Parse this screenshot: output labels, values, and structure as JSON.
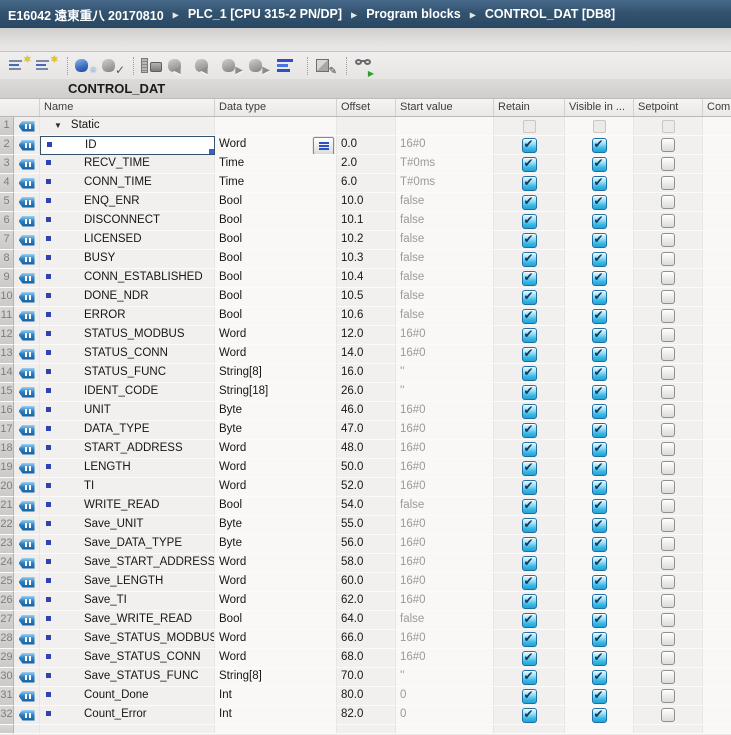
{
  "breadcrumb": {
    "segments": [
      "E16042 遠東重八 20170810",
      "PLC_1 [CPU 315-2 PN/DP]",
      "Program blocks",
      "CONTROL_DAT [DB8]"
    ]
  },
  "toolbar": {
    "icons": [
      {
        "name": "insert-row",
        "kind": "rows-star"
      },
      {
        "name": "add-row",
        "kind": "rows-star"
      },
      {
        "name": "sep1",
        "kind": "sep"
      },
      {
        "name": "keep-actual-values",
        "kind": "db-blue"
      },
      {
        "name": "snapshot-ok",
        "kind": "db-check"
      },
      {
        "name": "sep2",
        "kind": "sep"
      },
      {
        "name": "snapshot-actual-values",
        "kind": "ruler-cam"
      },
      {
        "name": "copy-snapshot-to-start",
        "kind": "db-left"
      },
      {
        "name": "copy-all-snapshots-to-start",
        "kind": "db-left2"
      },
      {
        "name": "load-start-as-actual",
        "kind": "db-right"
      },
      {
        "name": "load-actual-as-start",
        "kind": "db-right2"
      },
      {
        "name": "expanded-mode",
        "kind": "lines-blue"
      },
      {
        "name": "sep3",
        "kind": "sep"
      },
      {
        "name": "initialize-setpoints",
        "kind": "window-edit"
      },
      {
        "name": "sep4",
        "kind": "sep"
      },
      {
        "name": "monitor-all",
        "kind": "glasses"
      }
    ]
  },
  "title": "CONTROL_DAT",
  "colors": {
    "topbar": "#2d4e6a",
    "checkbox_checked": "#2fb0dc",
    "tag_blue": "#1f78c0",
    "selection_border": "#33526e",
    "start_value_gray": "#9b9a99"
  },
  "table": {
    "columns": [
      {
        "key": "name",
        "label": "Name"
      },
      {
        "key": "type",
        "label": "Data type"
      },
      {
        "key": "offset",
        "label": "Offset"
      },
      {
        "key": "start",
        "label": "Start value"
      },
      {
        "key": "retain",
        "label": "Retain"
      },
      {
        "key": "visible",
        "label": "Visible in ..."
      },
      {
        "key": "set",
        "label": "Setpoint"
      },
      {
        "key": "com",
        "label": "Comment"
      }
    ],
    "rows": [
      {
        "num": 1,
        "group": true,
        "name": "Static"
      },
      {
        "num": 2,
        "name": "ID",
        "type": "Word",
        "offset": "0.0",
        "start": "16#0",
        "retain": true,
        "visible": true,
        "setpoint": false,
        "selected": true
      },
      {
        "num": 3,
        "name": "RECV_TIME",
        "type": "Time",
        "offset": "2.0",
        "start": "T#0ms",
        "retain": true,
        "visible": true,
        "setpoint": false
      },
      {
        "num": 4,
        "name": "CONN_TIME",
        "type": "Time",
        "offset": "6.0",
        "start": "T#0ms",
        "retain": true,
        "visible": true,
        "setpoint": false
      },
      {
        "num": 5,
        "name": "ENQ_ENR",
        "type": "Bool",
        "offset": "10.0",
        "start": "false",
        "retain": true,
        "visible": true,
        "setpoint": false
      },
      {
        "num": 6,
        "name": "DISCONNECT",
        "type": "Bool",
        "offset": "10.1",
        "start": "false",
        "retain": true,
        "visible": true,
        "setpoint": false
      },
      {
        "num": 7,
        "name": "LICENSED",
        "type": "Bool",
        "offset": "10.2",
        "start": "false",
        "retain": true,
        "visible": true,
        "setpoint": false
      },
      {
        "num": 8,
        "name": "BUSY",
        "type": "Bool",
        "offset": "10.3",
        "start": "false",
        "retain": true,
        "visible": true,
        "setpoint": false
      },
      {
        "num": 9,
        "name": "CONN_ESTABLISHED",
        "type": "Bool",
        "offset": "10.4",
        "start": "false",
        "retain": true,
        "visible": true,
        "setpoint": false
      },
      {
        "num": 10,
        "name": "DONE_NDR",
        "type": "Bool",
        "offset": "10.5",
        "start": "false",
        "retain": true,
        "visible": true,
        "setpoint": false
      },
      {
        "num": 11,
        "name": "ERROR",
        "type": "Bool",
        "offset": "10.6",
        "start": "false",
        "retain": true,
        "visible": true,
        "setpoint": false
      },
      {
        "num": 12,
        "name": "STATUS_MODBUS",
        "type": "Word",
        "offset": "12.0",
        "start": "16#0",
        "retain": true,
        "visible": true,
        "setpoint": false
      },
      {
        "num": 13,
        "name": "STATUS_CONN",
        "type": "Word",
        "offset": "14.0",
        "start": "16#0",
        "retain": true,
        "visible": true,
        "setpoint": false
      },
      {
        "num": 14,
        "name": "STATUS_FUNC",
        "type": "String[8]",
        "offset": "16.0",
        "start": "''",
        "retain": true,
        "visible": true,
        "setpoint": false
      },
      {
        "num": 15,
        "name": "IDENT_CODE",
        "type": "String[18]",
        "offset": "26.0",
        "start": "''",
        "retain": true,
        "visible": true,
        "setpoint": false
      },
      {
        "num": 16,
        "name": "UNIT",
        "type": "Byte",
        "offset": "46.0",
        "start": "16#0",
        "retain": true,
        "visible": true,
        "setpoint": false
      },
      {
        "num": 17,
        "name": "DATA_TYPE",
        "type": "Byte",
        "offset": "47.0",
        "start": "16#0",
        "retain": true,
        "visible": true,
        "setpoint": false
      },
      {
        "num": 18,
        "name": "START_ADDRESS",
        "type": "Word",
        "offset": "48.0",
        "start": "16#0",
        "retain": true,
        "visible": true,
        "setpoint": false
      },
      {
        "num": 19,
        "name": "LENGTH",
        "type": "Word",
        "offset": "50.0",
        "start": "16#0",
        "retain": true,
        "visible": true,
        "setpoint": false
      },
      {
        "num": 20,
        "name": "TI",
        "type": "Word",
        "offset": "52.0",
        "start": "16#0",
        "retain": true,
        "visible": true,
        "setpoint": false
      },
      {
        "num": 21,
        "name": "WRITE_READ",
        "type": "Bool",
        "offset": "54.0",
        "start": "false",
        "retain": true,
        "visible": true,
        "setpoint": false
      },
      {
        "num": 22,
        "name": "Save_UNIT",
        "type": "Byte",
        "offset": "55.0",
        "start": "16#0",
        "retain": true,
        "visible": true,
        "setpoint": false
      },
      {
        "num": 23,
        "name": "Save_DATA_TYPE",
        "type": "Byte",
        "offset": "56.0",
        "start": "16#0",
        "retain": true,
        "visible": true,
        "setpoint": false
      },
      {
        "num": 24,
        "name": "Save_START_ADDRESS",
        "type": "Word",
        "offset": "58.0",
        "start": "16#0",
        "retain": true,
        "visible": true,
        "setpoint": false
      },
      {
        "num": 25,
        "name": "Save_LENGTH",
        "type": "Word",
        "offset": "60.0",
        "start": "16#0",
        "retain": true,
        "visible": true,
        "setpoint": false
      },
      {
        "num": 26,
        "name": "Save_TI",
        "type": "Word",
        "offset": "62.0",
        "start": "16#0",
        "retain": true,
        "visible": true,
        "setpoint": false
      },
      {
        "num": 27,
        "name": "Save_WRITE_READ",
        "type": "Bool",
        "offset": "64.0",
        "start": "false",
        "retain": true,
        "visible": true,
        "setpoint": false
      },
      {
        "num": 28,
        "name": "Save_STATUS_MODBUS",
        "type": "Word",
        "offset": "66.0",
        "start": "16#0",
        "retain": true,
        "visible": true,
        "setpoint": false
      },
      {
        "num": 29,
        "name": "Save_STATUS_CONN",
        "type": "Word",
        "offset": "68.0",
        "start": "16#0",
        "retain": true,
        "visible": true,
        "setpoint": false
      },
      {
        "num": 30,
        "name": "Save_STATUS_FUNC",
        "type": "String[8]",
        "offset": "70.0",
        "start": "''",
        "retain": true,
        "visible": true,
        "setpoint": false
      },
      {
        "num": 31,
        "name": "Count_Done",
        "type": "Int",
        "offset": "80.0",
        "start": "0",
        "retain": true,
        "visible": true,
        "setpoint": false
      },
      {
        "num": 32,
        "name": "Count_Error",
        "type": "Int",
        "offset": "82.0",
        "start": "0",
        "retain": true,
        "visible": true,
        "setpoint": false
      }
    ]
  }
}
